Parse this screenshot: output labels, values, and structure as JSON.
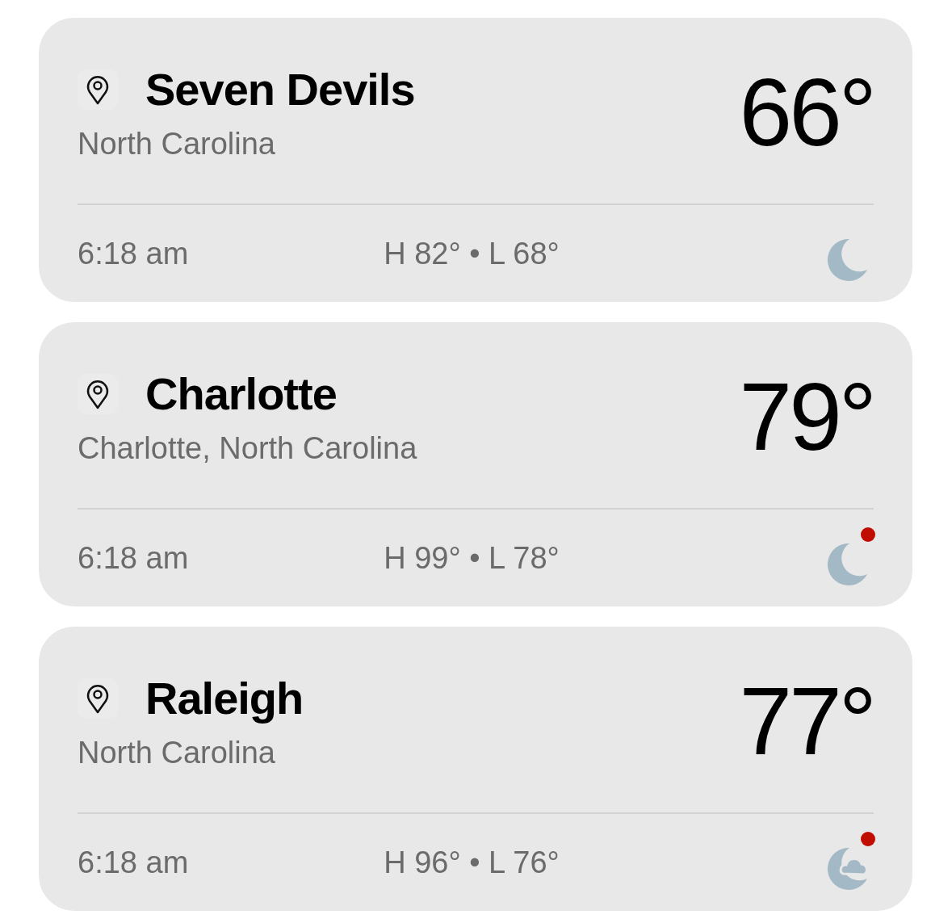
{
  "locations": [
    {
      "name": "Seven Devils",
      "region": "North Carolina",
      "temperature": "66°",
      "time": "6:18 am",
      "high_low": "H 82° • L 68°",
      "kind": "moon",
      "alert": false
    },
    {
      "name": "Charlotte",
      "region": "Charlotte, North Carolina",
      "temperature": "79°",
      "time": "6:18 am",
      "high_low": "H 99° • L 78°",
      "kind": "moon",
      "alert": true
    },
    {
      "name": "Raleigh",
      "region": "North Carolina",
      "temperature": "77°",
      "time": "6:18 am",
      "high_low": "H 96° • L 76°",
      "kind": "cloudy",
      "alert": true
    }
  ]
}
